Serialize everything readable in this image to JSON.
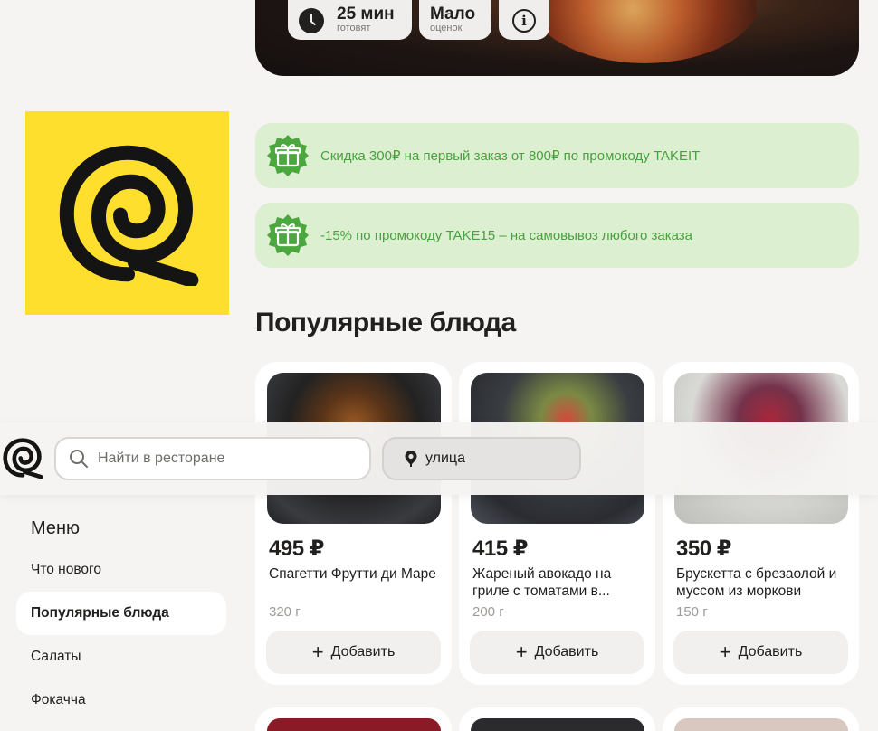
{
  "hero": {
    "time_value": "25 мин",
    "time_caption": "готовят",
    "rating_value": "Мало",
    "rating_caption": "оценок",
    "info_icon": "info-icon"
  },
  "promos": [
    {
      "icon": "gift-icon",
      "text": "Скидка 300₽ на первый заказ от 800₽ по промокоду TAKEIT"
    },
    {
      "icon": "gift-icon",
      "text": "-15% по промокоду TAKE15 – на самовывоз любого заказа"
    }
  ],
  "section_title": "Популярные блюда",
  "cards": [
    {
      "price": "495 ₽",
      "name": "Спагетти Фрутти ди Маре",
      "weight": "320 г",
      "add_label": "Добавить"
    },
    {
      "price": "415 ₽",
      "name": "Жареный авокадо на гриле с томатами в...",
      "weight": "200 г",
      "add_label": "Добавить"
    },
    {
      "price": "350 ₽",
      "name": "Брускетта с брезаолой и муссом из моркови",
      "weight": "150 г",
      "add_label": "Добавить"
    }
  ],
  "header": {
    "search_placeholder": "Найти в ресторане",
    "address_value": "улица"
  },
  "menu": {
    "title": "Меню",
    "items": [
      {
        "label": "Что нового",
        "active": false
      },
      {
        "label": "Популярные блюда",
        "active": true
      },
      {
        "label": "Салаты",
        "active": false
      },
      {
        "label": "Фокачча",
        "active": false
      }
    ]
  },
  "colors": {
    "brand_yellow": "#ffdf2d",
    "promo_green": "#48a23f",
    "promo_bg": "#dcefd0",
    "page_bg": "#f5f4f2"
  }
}
